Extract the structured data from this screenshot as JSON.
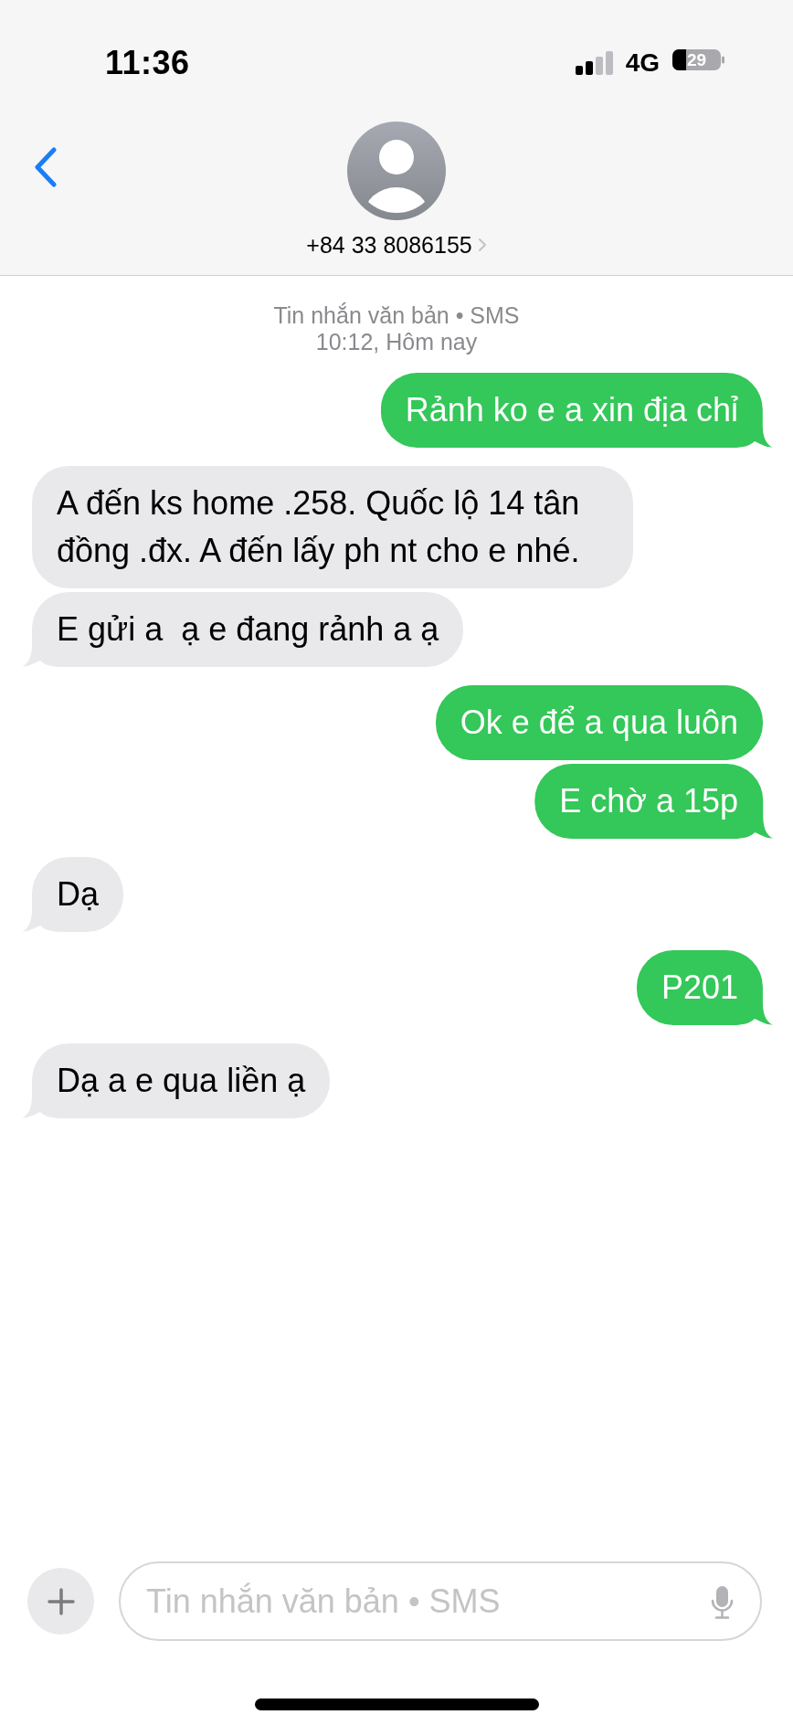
{
  "status_bar": {
    "time": "11:36",
    "network": "4G",
    "battery": "29"
  },
  "header": {
    "contact": "+84 33 8086155"
  },
  "conversation": {
    "service": "Tin nhắn văn bản • SMS",
    "timestamp": "10:12, Hôm nay",
    "messages": [
      {
        "kind": "sent",
        "text": "Rảnh ko e a xin địa chỉ"
      },
      {
        "kind": "received",
        "text": "A đến ks home .258. Quốc lộ 14 tân đồng .đx. A đến lấy ph nt cho e nhé."
      },
      {
        "kind": "received",
        "text": "E gửi a  ạ e đang rảnh a ạ"
      },
      {
        "kind": "sent",
        "text": "Ok e để a qua luôn"
      },
      {
        "kind": "sent",
        "text": "E chờ a 15p"
      },
      {
        "kind": "received",
        "text": "Dạ"
      },
      {
        "kind": "sent",
        "text": "P201"
      },
      {
        "kind": "received",
        "text": "Dạ a e qua liền ạ"
      }
    ]
  },
  "composer": {
    "placeholder": "Tin nhắn văn bản • SMS"
  }
}
